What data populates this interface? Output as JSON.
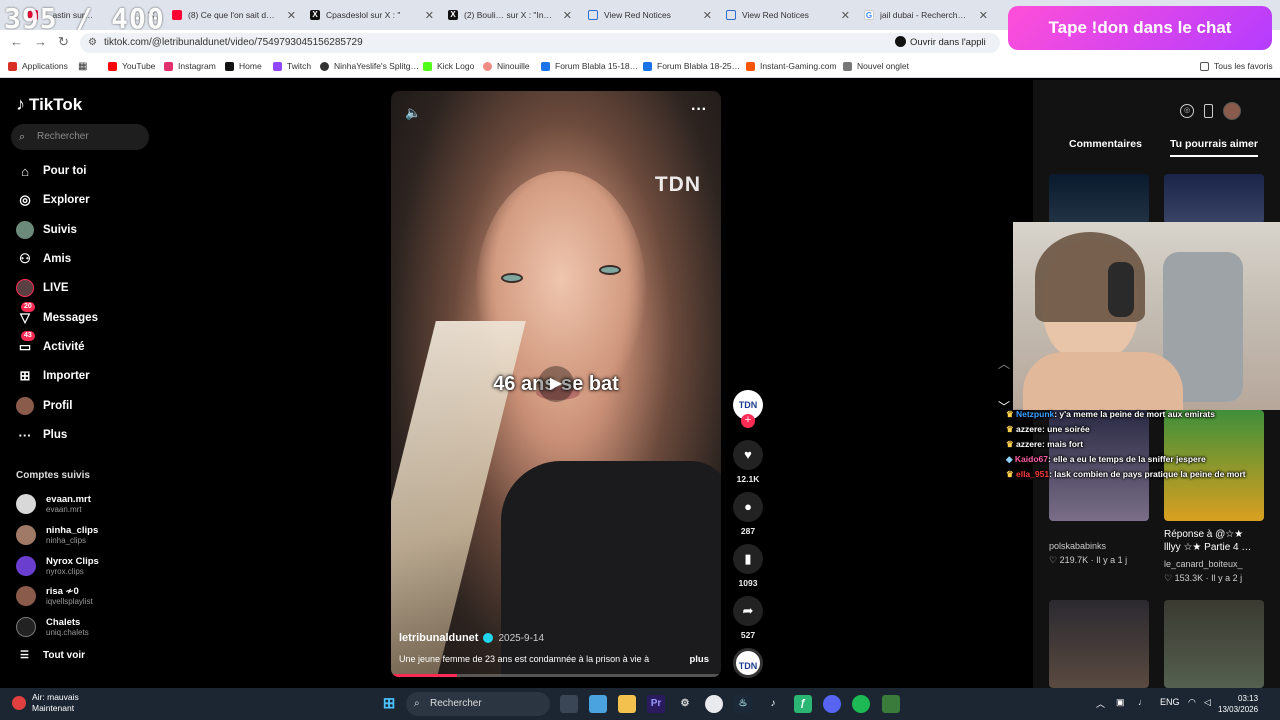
{
  "overlay": {
    "counter": "395 / 400",
    "don_banner": "Tape !don dans le chat"
  },
  "browser": {
    "tabs": [
      {
        "title": "…astin sur…",
        "icon_color": "#ff0033"
      },
      {
        "title": "(8) Ce que l'on sait de l'évo…",
        "icon_color": "#ff0033"
      },
      {
        "title": "Cpasdeslol sur X : \"",
        "icon_color": "#111111"
      },
      {
        "title": "(2) Bouli… sur X : \"Insol…",
        "icon_color": "#111111"
      },
      {
        "title": "View Red Notices",
        "icon_color": "#2c6fd1"
      },
      {
        "title": "View Red Notices",
        "icon_color": "#2c6fd1"
      },
      {
        "title": "jail dubai - Recherche Go…",
        "icon_color": "#4285f4"
      }
    ],
    "url": "tiktok.com/@letribunaldunet/video/7549793045156285729",
    "open_app": "Ouvrir dans l'appli",
    "bookmarks": [
      {
        "label": "Applications",
        "color": "#d93025"
      },
      {
        "label": "YouTube",
        "color": "#ff0000"
      },
      {
        "label": "Instagram",
        "color": "#e1306c"
      },
      {
        "label": "Home",
        "color": "#111111"
      },
      {
        "label": "Twitch",
        "color": "#9146ff"
      },
      {
        "label": "NinhaYeslife's Splitg…",
        "color": "#333333"
      },
      {
        "label": "Kick Logo",
        "color": "#53fc18"
      },
      {
        "label": "Ninouille",
        "color": "#f28b82"
      },
      {
        "label": "Forum Blabla 15-18…",
        "color": "#1a73e8"
      },
      {
        "label": "Forum Blabla 18-25…",
        "color": "#1a73e8"
      },
      {
        "label": "Instant-Gaming.com",
        "color": "#ff5400"
      },
      {
        "label": "Nouvel onglet",
        "color": "#777777"
      }
    ],
    "all_favorites": "Tous les favoris"
  },
  "tiktok": {
    "logo": "TikTok",
    "search_placeholder": "Rechercher",
    "nav": [
      {
        "label": "Pour toi",
        "icon": "home-icon"
      },
      {
        "label": "Explorer",
        "icon": "compass-icon"
      },
      {
        "label": "Suivis",
        "icon": "following-icon"
      },
      {
        "label": "Amis",
        "icon": "friends-icon"
      },
      {
        "label": "LIVE",
        "icon": "live-icon"
      },
      {
        "label": "Messages",
        "icon": "messages-icon",
        "badge": "20"
      },
      {
        "label": "Activité",
        "icon": "activity-icon",
        "badge": "43"
      },
      {
        "label": "Importer",
        "icon": "upload-icon"
      },
      {
        "label": "Profil",
        "icon": "profile-icon"
      },
      {
        "label": "Plus",
        "icon": "more-icon"
      }
    ],
    "followed_title": "Comptes suivis",
    "followed": [
      {
        "name": "evaan.mrt",
        "handle": "evaan.mrt",
        "color": "#d8d8d8"
      },
      {
        "name": "ninha_clips",
        "handle": "ninha_clips",
        "color": "#a07a66"
      },
      {
        "name": "Nyrox Clips",
        "handle": "nyrox.clips",
        "color": "#6a3fd0"
      },
      {
        "name": "risa ≁0",
        "handle": "iqvellsplaylist",
        "color": "#8a5a4a"
      },
      {
        "name": "Chalets",
        "handle": "uniq.chalets",
        "color": "#222222"
      }
    ],
    "see_all": "Tout voir",
    "video": {
      "watermark": "TDN",
      "caption": "46 ans se bat",
      "author": "letribunaldunet",
      "date": "2025-9-14",
      "description": "Une jeune femme de 23 ans est condamnée à la prison à vie à",
      "more": "plus",
      "progress": 0.2
    },
    "actions": {
      "avatar": "TDN",
      "likes": "12.1K",
      "comments": "287",
      "saves": "1093",
      "shares": "527",
      "disc": "TDN"
    },
    "right": {
      "tab_comments": "Commentaires",
      "tab_suggested": "Tu pourrais aimer",
      "cards": [
        {
          "title": "",
          "user": "polskababinks",
          "likes": "219.7K",
          "time": "Il y a 1 j"
        },
        {
          "title": "Réponse à @☆★ lllyy ☆★ Partie 4 …",
          "user": "le_canard_boiteux_",
          "likes": "153.3K",
          "time": "Il y a 2 j"
        }
      ]
    }
  },
  "chat": [
    {
      "user": "Netzpunk",
      "user_color": "#3aa0ff",
      "text": ": y'a meme la peine de mort aux emirats"
    },
    {
      "user": "azzere",
      "user_color": "#ffffff",
      "text": ": une soirée"
    },
    {
      "user": "azzere",
      "user_color": "#ffffff",
      "text": ": mais fort"
    },
    {
      "user": "Kaido67",
      "user_color": "#ff5ea8",
      "text": ": elle a eu le temps de la sniffer jespere"
    },
    {
      "user": "ella_951",
      "user_color": "#ff3b3b",
      "text": ": lask combien de pays pratique la peine de mort"
    }
  ],
  "taskbar": {
    "weather_title": "Air: mauvais",
    "weather_sub": "Maintenant",
    "search": "Rechercher",
    "lang": "ENG",
    "time": "03:13",
    "date": "13/03/2026"
  }
}
